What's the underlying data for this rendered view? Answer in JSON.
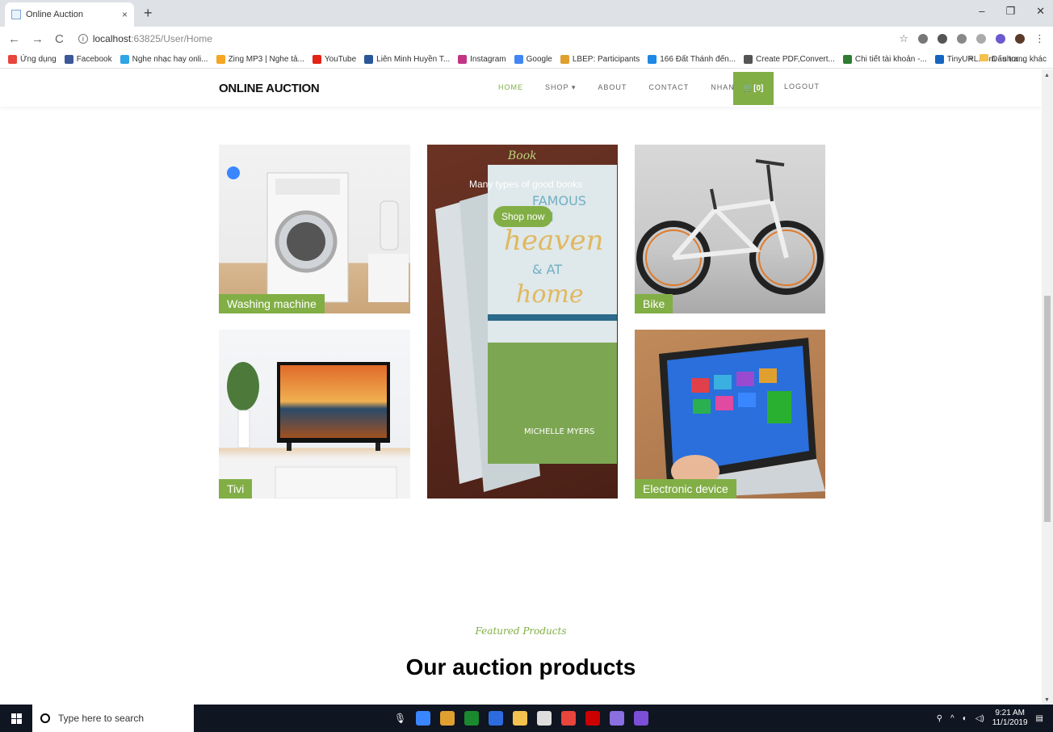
{
  "browser": {
    "tab_title": "Online Auction",
    "tab_close": "×",
    "new_tab": "+",
    "window_controls": [
      "–",
      "❐",
      "✕"
    ],
    "nav": {
      "back": "←",
      "forward": "→",
      "reload": "C"
    },
    "url_host": "localhost",
    "url_rest": ":63825/User/Home",
    "bookmarks": [
      {
        "label": "Ứng dụng",
        "color": "#e8453c"
      },
      {
        "label": "Facebook",
        "color": "#3b5998"
      },
      {
        "label": "Nghe nhạc hay onli...",
        "color": "#2fa4e7"
      },
      {
        "label": "Zing MP3 | Nghe tả...",
        "color": "#f5a623"
      },
      {
        "label": "YouTube",
        "color": "#e62117"
      },
      {
        "label": "Liên Minh Huyền T...",
        "color": "#2b579a"
      },
      {
        "label": "Instagram",
        "color": "#c13584"
      },
      {
        "label": "Google",
        "color": "#4285f4"
      },
      {
        "label": "LBEP: Participants",
        "color": "#e0a030"
      },
      {
        "label": "166 Đất Thánh đến...",
        "color": "#1e88e5"
      },
      {
        "label": "Create PDF,Convert...",
        "color": "#555555"
      },
      {
        "label": "Chi tiết tài khoản -...",
        "color": "#2e7d32"
      },
      {
        "label": "TinyURL.com - shor...",
        "color": "#1565c0"
      }
    ],
    "bookmarks_overflow": "»",
    "other_bookmarks": "Dấu trang khác"
  },
  "site": {
    "brand": "ONLINE AUCTION",
    "menu": {
      "home": "HOME",
      "shop": "SHOP ▾",
      "about": "ABOUT",
      "contact": "CONTACT",
      "nhan": "NHAN",
      "cart": "🛒[0]",
      "logout": "LOGOUT"
    },
    "categories": {
      "washing": "Washing machine",
      "tivi": "Tivi",
      "bike": "Bike",
      "electronic": "Electronic device",
      "book_title": "Book",
      "book_sub": "Many types of good books",
      "shop_now": "Shop now"
    },
    "featured_sub": "Featured Products",
    "featured_title": "Our auction products"
  },
  "taskbar": {
    "search_placeholder": "Type here to search",
    "time": "9:21 AM",
    "date": "11/1/2019",
    "icons": [
      "#3a86ff",
      "#e0a030",
      "#1b8a2e",
      "#2d6cdf",
      "#f2c14e",
      "#ddd",
      "#e8453c",
      "#c00",
      "#8a6fe0",
      "#7b4fd6"
    ]
  },
  "colors": {
    "accent": "#82ae46"
  }
}
